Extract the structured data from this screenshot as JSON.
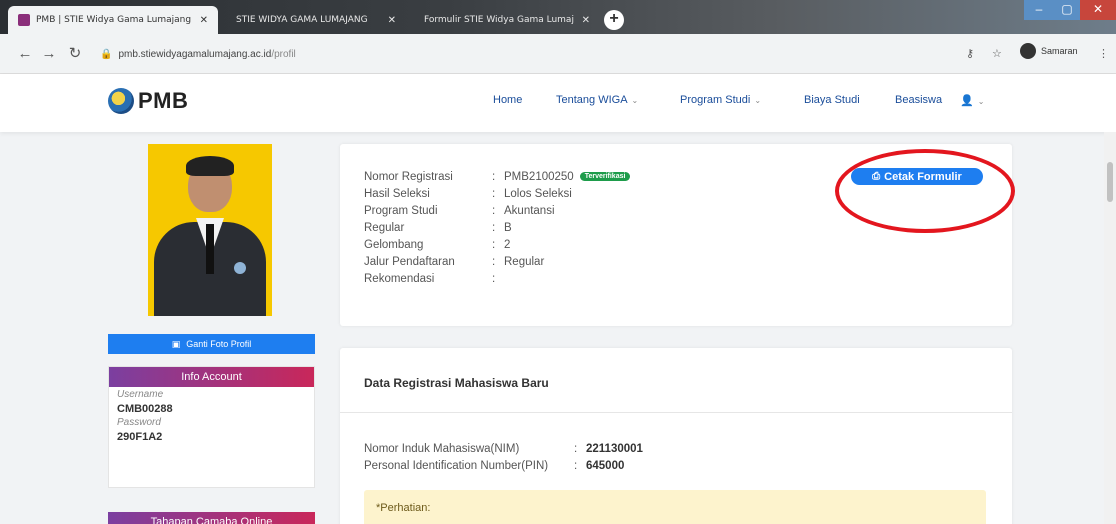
{
  "browser": {
    "tabs": [
      {
        "title": "PMB | STIE Widya Gama Lumajang",
        "favicon_color": "#8a2e7a"
      },
      {
        "title": "STIE WIDYA GAMA LUMAJANG",
        "favicon_color": "#3a3e42"
      },
      {
        "title": "Formulir STIE Widya Gama Lumajang",
        "favicon_color": "#3a3e42"
      }
    ],
    "new_tab": "+",
    "address": {
      "host": "pmb.stiewidyagamalumajang.ac.id",
      "path": "/profil"
    },
    "profile_name": "Samaran",
    "window_controls": {
      "minimize": "–",
      "maximize": "▢",
      "close": "✕"
    }
  },
  "site": {
    "logo_text": "PMB",
    "nav": [
      {
        "label": "Home",
        "dropdown": false
      },
      {
        "label": "Tentang WIGA",
        "dropdown": true
      },
      {
        "label": "Program Studi",
        "dropdown": true
      },
      {
        "label": "Biaya Studi",
        "dropdown": false
      },
      {
        "label": "Beasiswa",
        "dropdown": false
      }
    ],
    "user_menu_icon": "user-icon"
  },
  "sidebar": {
    "change_photo_label": "Ganti Foto Profil",
    "info_account": {
      "title": "Info Account",
      "username_label": "Username",
      "username": "CMB00288",
      "password_label": "Password",
      "password": "290F1A2"
    },
    "tahapan_title": "Tahapan Camaba Online"
  },
  "registration": {
    "rows": [
      {
        "label": "Nomor Registrasi",
        "value": "PMB2100250"
      },
      {
        "label": "Hasil Seleksi",
        "value": "Lolos Seleksi"
      },
      {
        "label": "Program Studi",
        "value": "Akuntansi"
      },
      {
        "label": "Regular",
        "value": "B"
      },
      {
        "label": "Gelombang",
        "value": "2"
      },
      {
        "label": "Jalur Pendaftaran",
        "value": "Regular"
      },
      {
        "label": "Rekomendasi",
        "value": ""
      }
    ],
    "separator": ":",
    "verified_badge": "Terverifikasi",
    "print_button": "Cetak Formulir"
  },
  "student_data": {
    "title": "Data Registrasi Mahasiswa Baru",
    "rows": [
      {
        "label": "Nomor Induk Mahasiswa(NIM)",
        "value": "221130001"
      },
      {
        "label": "Personal Identification Number(PIN)",
        "value": "645000"
      }
    ],
    "notice_title": "*Perhatian:"
  },
  "colors": {
    "primary_button": "#1e7ef0",
    "verified": "#1e9c4b",
    "header_gradient_start": "#7b3fa0",
    "header_gradient_end": "#c9275a",
    "annotation": "#e3161e",
    "nav_link": "#1a4d9a"
  }
}
